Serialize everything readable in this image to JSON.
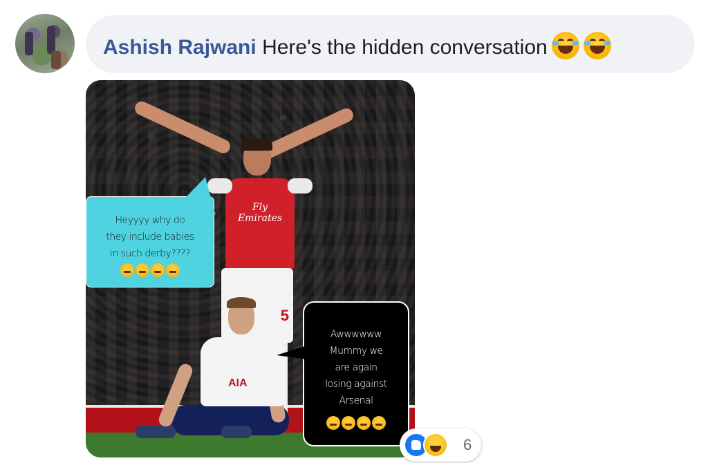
{
  "comment": {
    "author": "Ashish Rajwani",
    "text": "Here's the hidden conversation",
    "emojis": [
      "face-with-tears-of-joy",
      "face-with-tears-of-joy"
    ]
  },
  "meme": {
    "top_bubble": {
      "lines": [
        "Heyyyy why do",
        "they include babies",
        "in such derby????"
      ],
      "emoji_count": 4
    },
    "bottom_bubble": {
      "lines": [
        "Awwwwww",
        "Mummy we",
        "are again",
        "losing against",
        "Arsenal"
      ],
      "emoji_count": 4
    },
    "shirt_sponsor": "Fly\nEmirates",
    "shirt_number": "5",
    "other_shirt_sponsor": "AIA"
  },
  "reactions": {
    "types": [
      "like",
      "haha"
    ],
    "count": "6"
  },
  "colors": {
    "author": "#385898",
    "bubble_bg": "#f0f2f5",
    "cyan_bubble": "#4fd3e0",
    "like_blue": "#1877f2"
  }
}
